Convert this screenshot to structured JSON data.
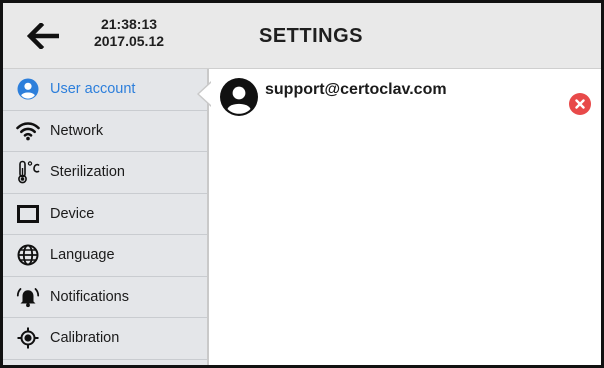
{
  "header": {
    "back_icon": "arrow-left-icon",
    "time": "21:38:13",
    "date": "2017.05.12",
    "title": "SETTINGS"
  },
  "sidebar": {
    "items": [
      {
        "label": "User account",
        "icon": "user-circle-icon",
        "active": true
      },
      {
        "label": "Network",
        "icon": "wifi-icon",
        "active": false
      },
      {
        "label": "Sterilization",
        "icon": "thermometer-icon",
        "active": false
      },
      {
        "label": "Device",
        "icon": "device-screen-icon",
        "active": false
      },
      {
        "label": "Language",
        "icon": "globe-icon",
        "active": false
      },
      {
        "label": "Notifications",
        "icon": "bell-icon",
        "active": false
      },
      {
        "label": "Calibration",
        "icon": "target-icon",
        "active": false
      }
    ]
  },
  "main": {
    "account": {
      "email": "support@certoclav.com",
      "avatar_icon": "avatar-icon",
      "remove_icon": "remove-icon"
    }
  },
  "colors": {
    "accent": "#2d7fdb",
    "remove": "#e84a4a",
    "header_bg": "#e9e9e9",
    "sidebar_bg": "#e4e6e9"
  }
}
